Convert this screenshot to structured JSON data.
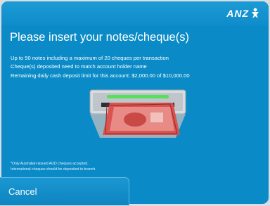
{
  "brand": {
    "logo_text": "ANZ",
    "accent": "#0a8bc7"
  },
  "main": {
    "title": "Please insert your notes/cheque(s)",
    "info_lines": [
      "Up to 50 notes including a maximum of 20 cheques per transaction",
      "Cheque(s) deposited need to match account holder name",
      "Remaining daily cash deposit limit for this account: $2,000.00 of $10,000.00"
    ],
    "illustration": "cash-deposit-slot-icon",
    "footnote_lines": [
      "*Only Australian-issued AUD cheques accepted.",
      "International cheques should be deposited in branch."
    ]
  },
  "actions": {
    "cancel_label": "Cancel"
  }
}
